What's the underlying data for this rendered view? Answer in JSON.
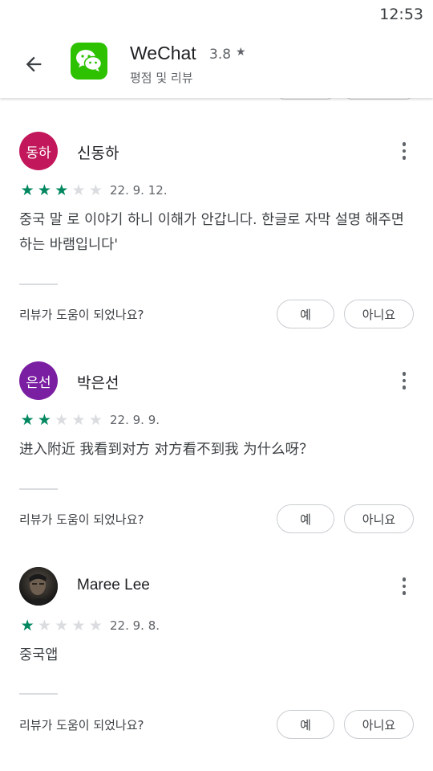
{
  "status_bar": {
    "time": "12:53"
  },
  "header": {
    "app_name": "WeChat",
    "rating": "3.8",
    "rating_star": "★",
    "subtitle": "평점 및 리뷰",
    "icon": "wechat-logo"
  },
  "reviews": [
    {
      "avatar_text": "동하",
      "avatar_color": "#c2185b",
      "name": "신동하",
      "stars": 3,
      "date": "22. 9. 12.",
      "text": "중국 말 로 이야기 하니 이해가 안갑니다. 한글로 자막 설명 해주면 하는 바램입니다'",
      "helpful_question": "리뷰가 도움이 되었나요?",
      "yes_label": "예",
      "no_label": "아니요"
    },
    {
      "avatar_text": "은선",
      "avatar_color": "#7b1fa2",
      "name": "박은선",
      "stars": 2,
      "date": "22. 9. 9.",
      "text": "进入附近 我看到对方 对方看不到我 为什么呀？",
      "helpful_question": "리뷰가 도움이 되었나요?",
      "yes_label": "예",
      "no_label": "아니요"
    },
    {
      "avatar_text": "",
      "avatar_color": "#2b2b2b",
      "name": "Maree Lee",
      "stars": 1,
      "date": "22. 9. 8.",
      "text": "중국앱",
      "helpful_question": "리뷰가 도움이 되었나요?",
      "yes_label": "예",
      "no_label": "아니요"
    }
  ],
  "colors": {
    "star_on": "#01875f",
    "star_off": "#dadce0",
    "wechat_green": "#2dc100"
  }
}
